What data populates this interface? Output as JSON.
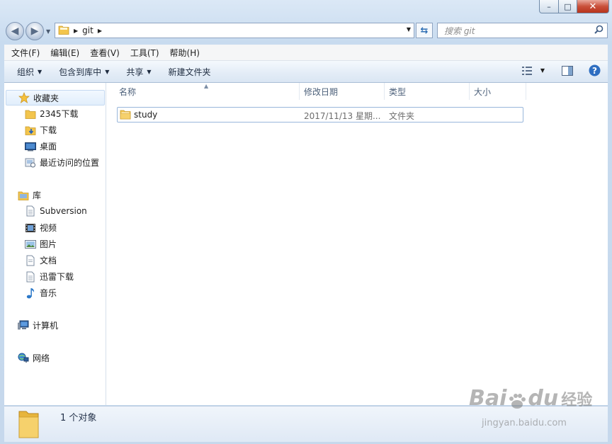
{
  "window": {
    "controls": {
      "min": "–",
      "max": "□",
      "close": "✕"
    }
  },
  "address": {
    "crumbs": [
      "git"
    ],
    "search_placeholder": "搜索 git"
  },
  "menu": [
    "文件(F)",
    "编辑(E)",
    "查看(V)",
    "工具(T)",
    "帮助(H)"
  ],
  "toolbar": {
    "organize": "组织",
    "include_in_library": "包含到库中",
    "share": "共享",
    "new_folder": "新建文件夹"
  },
  "nav": {
    "favorites": {
      "title": "收藏夹",
      "items": [
        "2345下载",
        "下载",
        "桌面",
        "最近访问的位置"
      ]
    },
    "libraries": {
      "title": "库",
      "items": [
        "Subversion",
        "视频",
        "图片",
        "文档",
        "迅雷下载",
        "音乐"
      ]
    },
    "computer": "计算机",
    "network": "网络"
  },
  "columns": [
    "名称",
    "修改日期",
    "类型",
    "大小"
  ],
  "files": [
    {
      "name": "study",
      "date": "2017/11/13 星期...",
      "type": "文件夹",
      "size": ""
    }
  ],
  "status": {
    "count_text": "1 个对象"
  },
  "watermark": {
    "brand": "Bai",
    "brand2": "du",
    "product": "经验",
    "url": "jingyan.baidu.com"
  },
  "colors": {
    "accent": "#3a7bd5",
    "folder": "#f3c54d",
    "selection_border": "#99b7db"
  }
}
